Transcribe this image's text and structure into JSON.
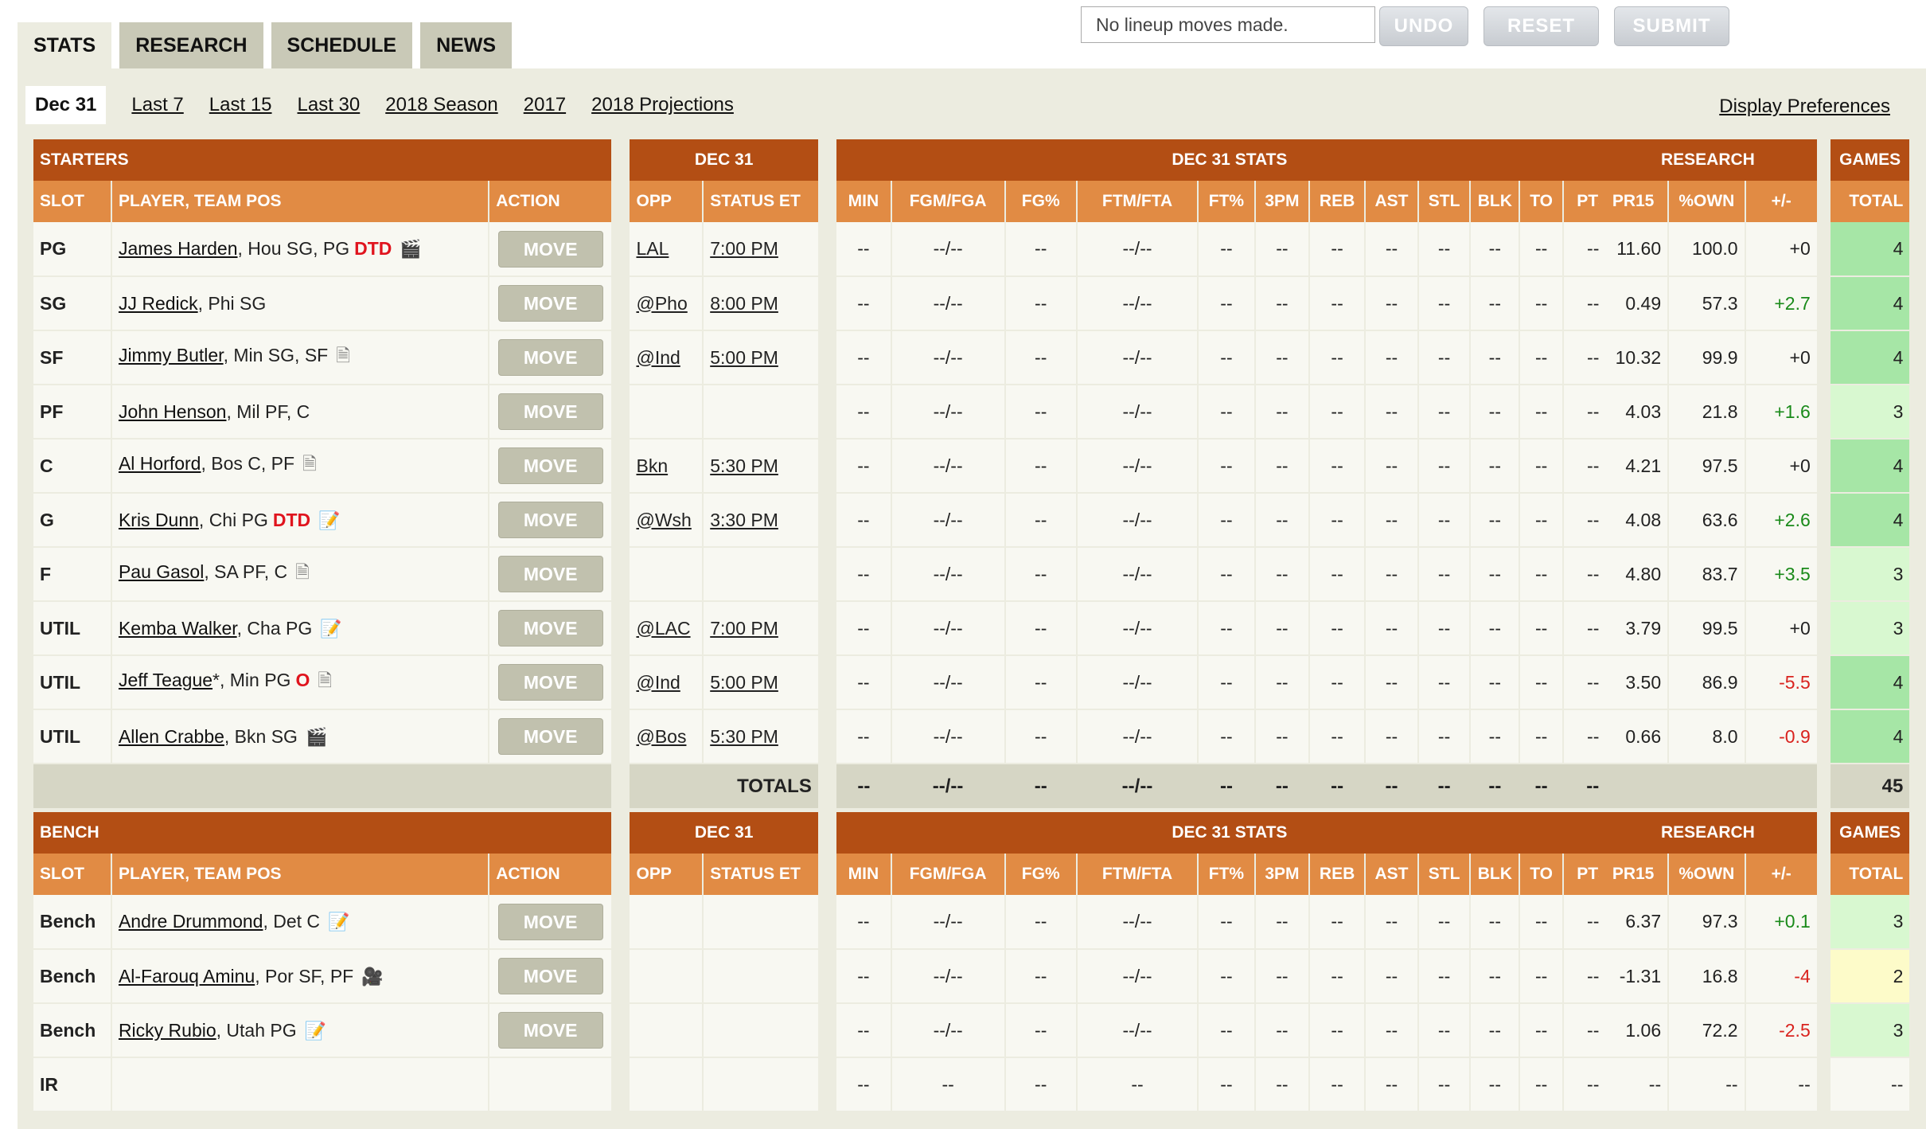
{
  "tabs": [
    "STATS",
    "RESEARCH",
    "SCHEDULE",
    "NEWS"
  ],
  "lineup_status": "No lineup moves made.",
  "buttons": {
    "undo": "UNDO",
    "reset": "RESET",
    "submit": "SUBMIT"
  },
  "periods": [
    "Dec 31",
    "Last 7",
    "Last 15",
    "Last 30",
    "2018 Season",
    "2017",
    "2018 Projections"
  ],
  "display_preferences": "Display Preferences",
  "section_headers": {
    "starters": "STARTERS",
    "bench": "BENCH",
    "date": "DEC 31",
    "stats": "DEC 31 STATS",
    "research": "RESEARCH",
    "games": "GAMES"
  },
  "columns": {
    "slot": "SLOT",
    "player": "PLAYER, TEAM POS",
    "action": "ACTION",
    "opp": "OPP",
    "status": "STATUS ET",
    "stats": [
      "MIN",
      "FGM/FGA",
      "FG%",
      "FTM/FTA",
      "FT%",
      "3PM",
      "REB",
      "AST",
      "STL",
      "BLK",
      "TO",
      "PTS"
    ],
    "research": [
      "PR15",
      "%OWN",
      "+/-"
    ],
    "total": "TOTAL"
  },
  "move_label": "MOVE",
  "starters": [
    {
      "slot": "PG",
      "name": "James Harden",
      "team": ", Hou SG, PG",
      "inj": "DTD",
      "icon": "video-note-icon",
      "opp": "LAL",
      "status": "7:00 PM",
      "stats": [
        "--",
        "--/--",
        "--",
        "--/--",
        "--",
        "--",
        "--",
        "--",
        "--",
        "--",
        "--",
        "--"
      ],
      "pr15": "11.60",
      "own": "100.0",
      "pm": "+0",
      "pmc": "",
      "games": "4",
      "gc": "g4"
    },
    {
      "slot": "SG",
      "name": "JJ Redick",
      "team": ", Phi SG",
      "inj": "",
      "icon": "",
      "opp": "@Pho",
      "status": "8:00 PM",
      "stats": [
        "--",
        "--/--",
        "--",
        "--/--",
        "--",
        "--",
        "--",
        "--",
        "--",
        "--",
        "--",
        "--"
      ],
      "pr15": "0.49",
      "own": "57.3",
      "pm": "+2.7",
      "pmc": "pos",
      "games": "4",
      "gc": "g4"
    },
    {
      "slot": "SF",
      "name": "Jimmy Butler",
      "team": ", Min SG, SF",
      "inj": "",
      "icon": "note-icon",
      "opp": "@Ind",
      "status": "5:00 PM",
      "stats": [
        "--",
        "--/--",
        "--",
        "--/--",
        "--",
        "--",
        "--",
        "--",
        "--",
        "--",
        "--",
        "--"
      ],
      "pr15": "10.32",
      "own": "99.9",
      "pm": "+0",
      "pmc": "",
      "games": "4",
      "gc": "g4"
    },
    {
      "slot": "PF",
      "name": "John Henson",
      "team": ", Mil PF, C",
      "inj": "",
      "icon": "",
      "opp": "",
      "status": "",
      "stats": [
        "--",
        "--/--",
        "--",
        "--/--",
        "--",
        "--",
        "--",
        "--",
        "--",
        "--",
        "--",
        "--"
      ],
      "pr15": "4.03",
      "own": "21.8",
      "pm": "+1.6",
      "pmc": "pos",
      "games": "3",
      "gc": "g3"
    },
    {
      "slot": "C",
      "name": "Al Horford",
      "team": ", Bos C, PF",
      "inj": "",
      "icon": "note-icon",
      "opp": "Bkn",
      "status": "5:30 PM",
      "stats": [
        "--",
        "--/--",
        "--",
        "--/--",
        "--",
        "--",
        "--",
        "--",
        "--",
        "--",
        "--",
        "--"
      ],
      "pr15": "4.21",
      "own": "97.5",
      "pm": "+0",
      "pmc": "",
      "games": "4",
      "gc": "g4"
    },
    {
      "slot": "G",
      "name": "Kris Dunn",
      "team": ", Chi PG",
      "inj": "DTD",
      "icon": "new-note-icon",
      "opp": "@Wsh",
      "status": "3:30 PM",
      "stats": [
        "--",
        "--/--",
        "--",
        "--/--",
        "--",
        "--",
        "--",
        "--",
        "--",
        "--",
        "--",
        "--"
      ],
      "pr15": "4.08",
      "own": "63.6",
      "pm": "+2.6",
      "pmc": "pos",
      "games": "4",
      "gc": "g4"
    },
    {
      "slot": "F",
      "name": "Pau Gasol",
      "team": ", SA PF, C",
      "inj": "",
      "icon": "note-icon",
      "opp": "",
      "status": "",
      "stats": [
        "--",
        "--/--",
        "--",
        "--/--",
        "--",
        "--",
        "--",
        "--",
        "--",
        "--",
        "--",
        "--"
      ],
      "pr15": "4.80",
      "own": "83.7",
      "pm": "+3.5",
      "pmc": "pos",
      "games": "3",
      "gc": "g3"
    },
    {
      "slot": "UTIL",
      "name": "Kemba Walker",
      "team": ", Cha PG",
      "inj": "",
      "icon": "new-note-icon",
      "opp": "@LAC",
      "status": "7:00 PM",
      "stats": [
        "--",
        "--/--",
        "--",
        "--/--",
        "--",
        "--",
        "--",
        "--",
        "--",
        "--",
        "--",
        "--"
      ],
      "pr15": "3.79",
      "own": "99.5",
      "pm": "+0",
      "pmc": "",
      "games": "3",
      "gc": "g3"
    },
    {
      "slot": "UTIL",
      "name": "Jeff Teague",
      "team": "*, Min PG",
      "inj": "O",
      "icon": "note-icon",
      "opp": "@Ind",
      "status": "5:00 PM",
      "stats": [
        "--",
        "--/--",
        "--",
        "--/--",
        "--",
        "--",
        "--",
        "--",
        "--",
        "--",
        "--",
        "--"
      ],
      "pr15": "3.50",
      "own": "86.9",
      "pm": "-5.5",
      "pmc": "neg",
      "games": "4",
      "gc": "g4"
    },
    {
      "slot": "UTIL",
      "name": "Allen Crabbe",
      "team": ", Bkn SG",
      "inj": "",
      "icon": "video-note-icon",
      "opp": "@Bos",
      "status": "5:30 PM",
      "stats": [
        "--",
        "--/--",
        "--",
        "--/--",
        "--",
        "--",
        "--",
        "--",
        "--",
        "--",
        "--",
        "--"
      ],
      "pr15": "0.66",
      "own": "8.0",
      "pm": "-0.9",
      "pmc": "neg",
      "games": "4",
      "gc": "g4"
    }
  ],
  "totals": {
    "label": "TOTALS",
    "stats": [
      "--",
      "--/--",
      "--",
      "--/--",
      "--",
      "--",
      "--",
      "--",
      "--",
      "--",
      "--",
      "--"
    ],
    "games": "45"
  },
  "bench": [
    {
      "slot": "Bench",
      "name": "Andre Drummond",
      "team": ", Det C",
      "inj": "",
      "icon": "new-note-icon",
      "opp": "",
      "status": "",
      "stats": [
        "--",
        "--/--",
        "--",
        "--/--",
        "--",
        "--",
        "--",
        "--",
        "--",
        "--",
        "--",
        "--"
      ],
      "pr15": "6.37",
      "own": "97.3",
      "pm": "+0.1",
      "pmc": "pos",
      "games": "3",
      "gc": "g3"
    },
    {
      "slot": "Bench",
      "name": "Al-Farouq Aminu",
      "team": ", Por SF, PF",
      "inj": "",
      "icon": "video-icon",
      "opp": "",
      "status": "",
      "stats": [
        "--",
        "--/--",
        "--",
        "--/--",
        "--",
        "--",
        "--",
        "--",
        "--",
        "--",
        "--",
        "--"
      ],
      "pr15": "-1.31",
      "own": "16.8",
      "pm": "-4",
      "pmc": "neg",
      "games": "2",
      "gc": "g2"
    },
    {
      "slot": "Bench",
      "name": "Ricky Rubio",
      "team": ", Utah PG",
      "inj": "",
      "icon": "new-note-icon",
      "opp": "",
      "status": "",
      "stats": [
        "--",
        "--/--",
        "--",
        "--/--",
        "--",
        "--",
        "--",
        "--",
        "--",
        "--",
        "--",
        "--"
      ],
      "pr15": "1.06",
      "own": "72.2",
      "pm": "-2.5",
      "pmc": "neg",
      "games": "3",
      "gc": "g3"
    },
    {
      "slot": "IR",
      "name": "",
      "team": "",
      "inj": "",
      "icon": "",
      "opp": "",
      "status": "",
      "stats": [
        "--",
        "--",
        "--",
        "--",
        "--",
        "--",
        "--",
        "--",
        "--",
        "--",
        "--",
        "--"
      ],
      "pr15": "--",
      "own": "--",
      "pm": "--",
      "pmc": "",
      "games": "--",
      "gc": ""
    }
  ]
}
